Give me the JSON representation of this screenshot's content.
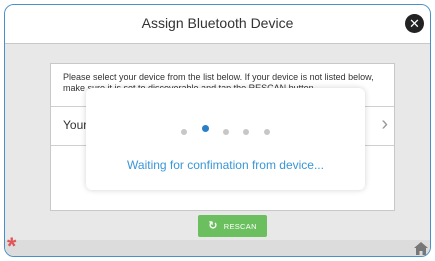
{
  "window": {
    "title": "Assign Bluetooth Device"
  },
  "panel": {
    "instructions": "Please select your device from the list below. If your device is not listed below, make sure it is set to discoverable and tap the RESCAN button.",
    "row_label": "Your"
  },
  "modal": {
    "message": "Waiting for confimation from device..."
  },
  "buttons": {
    "rescan_label": "RESCAN"
  },
  "icons": {
    "close": "close-icon",
    "rescan": "refresh-icon",
    "chevron": "chevron-right-icon",
    "logo": "asterisk-icon",
    "home": "home-icon"
  },
  "colors": {
    "accent": "#4a90c8",
    "message": "#3a96d6",
    "rescan": "#6bbf5f",
    "asterisk": "#e05555"
  }
}
